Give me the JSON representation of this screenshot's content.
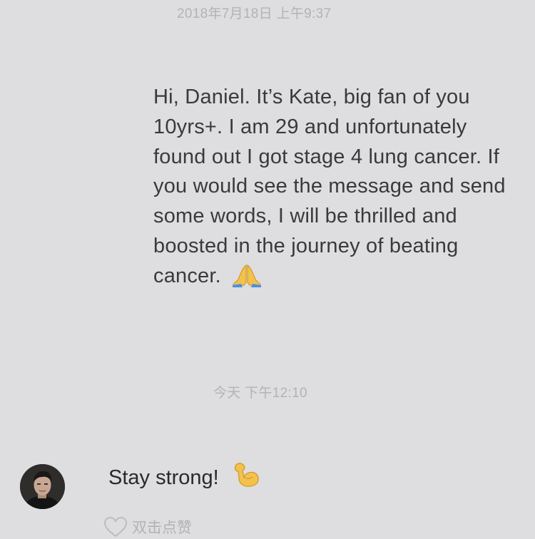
{
  "conversation": {
    "timestamp_1": "2018年7月18日 上午9:37",
    "outgoing_message": "Hi, Daniel. It’s Kate, big fan of you 10yrs+. I am 29 and unfortunately found out I got stage 4 lung cancer. If you would see the message and send some words, I will be thrilled and boosted in the journey of beating cancer.",
    "outgoing_emoji": "folded-hands-emoji",
    "timestamp_2": "今天 下午12:10",
    "incoming_message": "Stay strong!",
    "incoming_emoji": "flexed-biceps-emoji",
    "like_hint": "双击点赞"
  },
  "icons": {
    "avatar": "avatar",
    "like": "heart-outline-icon"
  },
  "colors": {
    "background": "#dedddf",
    "timestamp_text": "#b3b2b5",
    "message_text": "#3a3a3c",
    "emoji_yellow": "#f2c24c"
  }
}
